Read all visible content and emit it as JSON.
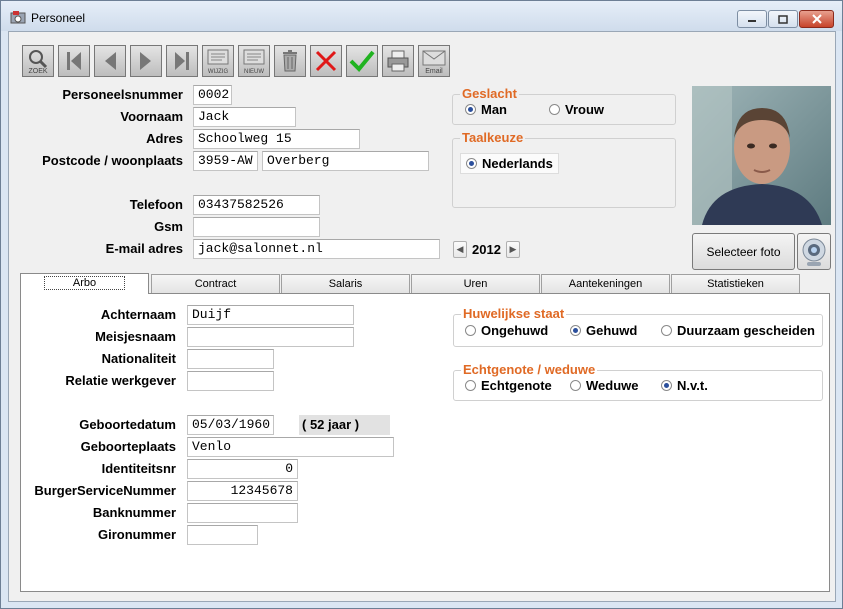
{
  "window": {
    "title": "Personeel"
  },
  "toolbar": {
    "zoek": "ZOEK",
    "wijzig": "WIJZIG",
    "nieuw": "NIEUW",
    "email": "Email"
  },
  "form": {
    "personeelsnummer": {
      "label": "Personeelsnummer",
      "value": "0002"
    },
    "voornaam": {
      "label": "Voornaam",
      "value": "Jack"
    },
    "adres": {
      "label": "Adres",
      "value": "Schoolweg 15"
    },
    "postcode": {
      "label": "Postcode / woonplaats",
      "postcode": "3959-AW",
      "woonplaats": "Overberg"
    },
    "telefoon": {
      "label": "Telefoon",
      "value": "03437582526"
    },
    "gsm": {
      "label": "Gsm",
      "value": ""
    },
    "email": {
      "label": "E-mail adres",
      "value": "jack@salonnet.nl"
    }
  },
  "year": "2012",
  "geslacht": {
    "title": "Geslacht",
    "options": [
      "Man",
      "Vrouw"
    ],
    "selected": "Man"
  },
  "taalkeuze": {
    "title": "Taalkeuze",
    "options": [
      "Nederlands"
    ],
    "selected": "Nederlands"
  },
  "photo": {
    "button": "Selecteer foto"
  },
  "tabs": [
    "Arbo",
    "Contract",
    "Salaris",
    "Uren",
    "Aantekeningen",
    "Statistieken"
  ],
  "arbo": {
    "achternaam": {
      "label": "Achternaam",
      "value": "Duijf"
    },
    "meisjesnaam": {
      "label": "Meisjesnaam",
      "value": ""
    },
    "nationaliteit": {
      "label": "Nationaliteit",
      "value": ""
    },
    "relatie": {
      "label": "Relatie werkgever",
      "value": ""
    },
    "geboortedatum": {
      "label": "Geboortedatum",
      "value": "05/03/1960",
      "age": "( 52 jaar )"
    },
    "geboorteplaats": {
      "label": "Geboorteplaats",
      "value": "Venlo"
    },
    "identiteitsnr": {
      "label": "Identiteitsnr",
      "value": "0"
    },
    "bsn": {
      "label": "BurgerServiceNummer",
      "value": "12345678"
    },
    "banknummer": {
      "label": "Banknummer",
      "value": ""
    },
    "gironummer": {
      "label": "Gironummer",
      "value": ""
    }
  },
  "huwelijk": {
    "title": "Huwelijkse staat",
    "options": [
      "Ongehuwd",
      "Gehuwd",
      "Duurzaam gescheiden"
    ],
    "selected": "Gehuwd"
  },
  "echtgenote": {
    "title": "Echtgenote / weduwe",
    "options": [
      "Echtgenote",
      "Weduwe",
      "N.v.t."
    ],
    "selected": "N.v.t."
  }
}
